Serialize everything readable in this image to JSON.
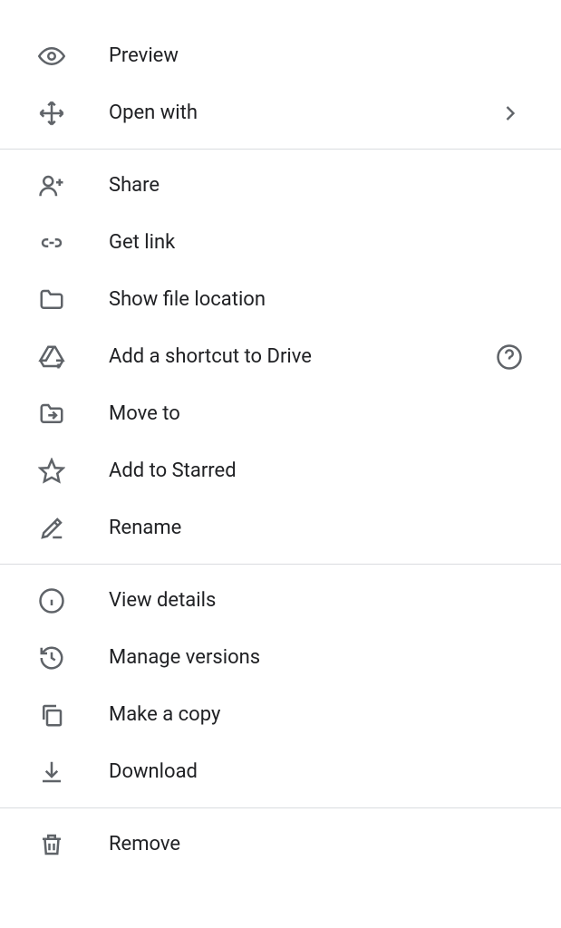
{
  "menu": {
    "preview": "Preview",
    "open_with": "Open with",
    "share": "Share",
    "get_link": "Get link",
    "show_location": "Show file location",
    "add_shortcut": "Add a shortcut to Drive",
    "move_to": "Move to",
    "add_starred": "Add to Starred",
    "rename": "Rename",
    "view_details": "View details",
    "manage_versions": "Manage versions",
    "make_copy": "Make a copy",
    "download": "Download",
    "remove": "Remove"
  }
}
